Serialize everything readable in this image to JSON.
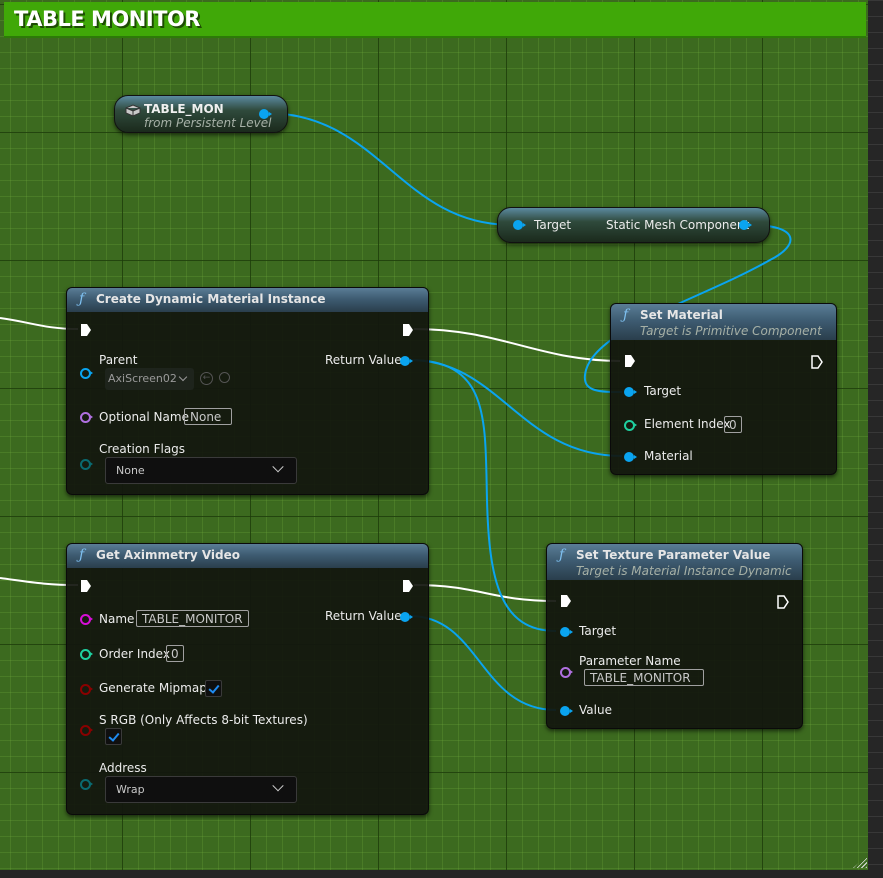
{
  "comment": {
    "title": "TABLE MONITOR",
    "color": "#40a808"
  },
  "colors": {
    "object_pin": "#0aa4f0",
    "string_pin": "#d60ed6",
    "name_pin": "#b070e0",
    "int_pin": "#1fd0a0",
    "bool_pin": "#8a0000",
    "enum_pin": "#0a6a70",
    "exec_wire": "#ffffff"
  },
  "nodes": {
    "table_mon": {
      "title": "TABLE_MON",
      "subtitle": "from Persistent Level",
      "icon": "actor-cube-icon"
    },
    "get_static_mesh": {
      "input_label": "Target",
      "output_label": "Static Mesh Component"
    },
    "create_dmi": {
      "title": "Create Dynamic Material Instance",
      "icon": "function-icon",
      "pins": {
        "parent_label": "Parent",
        "parent_value": "AxiScreen02",
        "return_label": "Return Value",
        "optional_name_label": "Optional Name",
        "optional_name_value": "None",
        "creation_flags_label": "Creation Flags",
        "creation_flags_value": "None"
      }
    },
    "set_material": {
      "title": "Set Material",
      "subtitle": "Target is Primitive Component",
      "icon": "function-icon",
      "pins": {
        "target_label": "Target",
        "element_index_label": "Element Index",
        "element_index_value": "0",
        "material_label": "Material"
      }
    },
    "get_aximmetry_video": {
      "title": "Get Aximmetry Video",
      "icon": "function-icon",
      "pins": {
        "name_label": "Name",
        "name_value": "TABLE_MONITOR",
        "return_label": "Return Value",
        "order_index_label": "Order Index",
        "order_index_value": "0",
        "generate_mipmaps_label": "Generate Mipmaps",
        "generate_mipmaps_checked": true,
        "srgb_label": "S RGB (Only Affects 8-bit Textures)",
        "srgb_checked": true,
        "address_label": "Address",
        "address_value": "Wrap"
      }
    },
    "set_texture_param": {
      "title": "Set Texture Parameter Value",
      "subtitle": "Target is Material Instance Dynamic",
      "icon": "function-icon",
      "pins": {
        "target_label": "Target",
        "parameter_name_label": "Parameter Name",
        "parameter_name_value": "TABLE_MONITOR",
        "value_label": "Value"
      }
    }
  }
}
